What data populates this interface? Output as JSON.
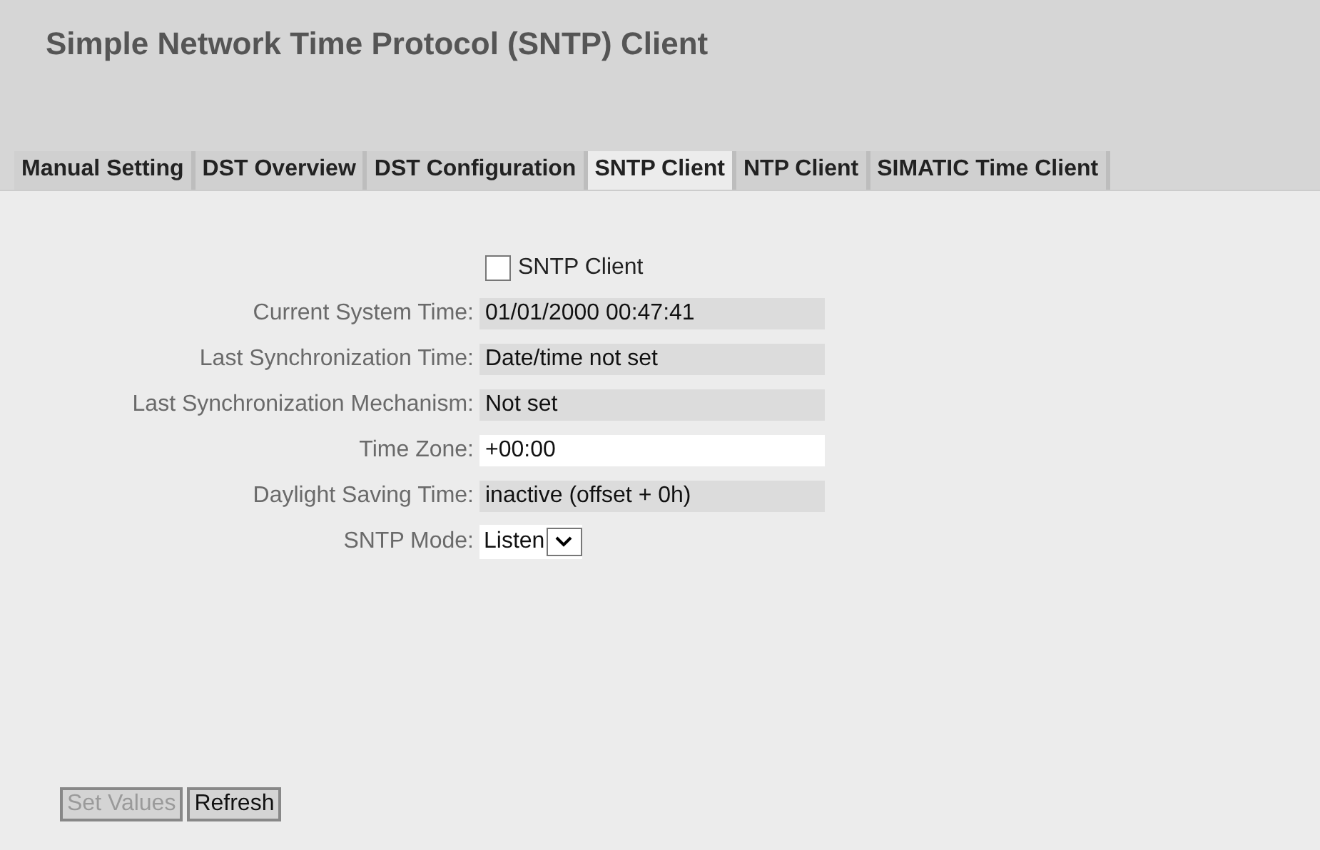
{
  "page_title": "Simple Network Time Protocol (SNTP) Client",
  "tabs": [
    {
      "label": "Manual Setting",
      "selected": false
    },
    {
      "label": "DST Overview",
      "selected": false
    },
    {
      "label": "DST Configuration",
      "selected": false
    },
    {
      "label": "SNTP Client",
      "selected": true
    },
    {
      "label": "NTP Client",
      "selected": false
    },
    {
      "label": "SIMATIC Time Client",
      "selected": false
    }
  ],
  "fields": [
    {
      "kind": "checkbox",
      "label": "SNTP Client",
      "checked": false
    },
    {
      "kind": "readonly",
      "label": "Current System Time:",
      "value": "01/01/2000 00:47:41"
    },
    {
      "kind": "readonly",
      "label": "Last Synchronization Time:",
      "value": "Date/time not set"
    },
    {
      "kind": "readonly",
      "label": "Last Synchronization Mechanism:",
      "value": "Not set"
    },
    {
      "kind": "input",
      "label": "Time Zone:",
      "value": "+00:00"
    },
    {
      "kind": "readonly",
      "label": "Daylight Saving Time:",
      "value": "inactive (offset + 0h)"
    },
    {
      "kind": "select",
      "label": "SNTP Mode:",
      "value": "Listen"
    }
  ],
  "buttons": [
    {
      "label": "Set Values",
      "disabled": true
    },
    {
      "label": "Refresh",
      "disabled": false
    }
  ]
}
